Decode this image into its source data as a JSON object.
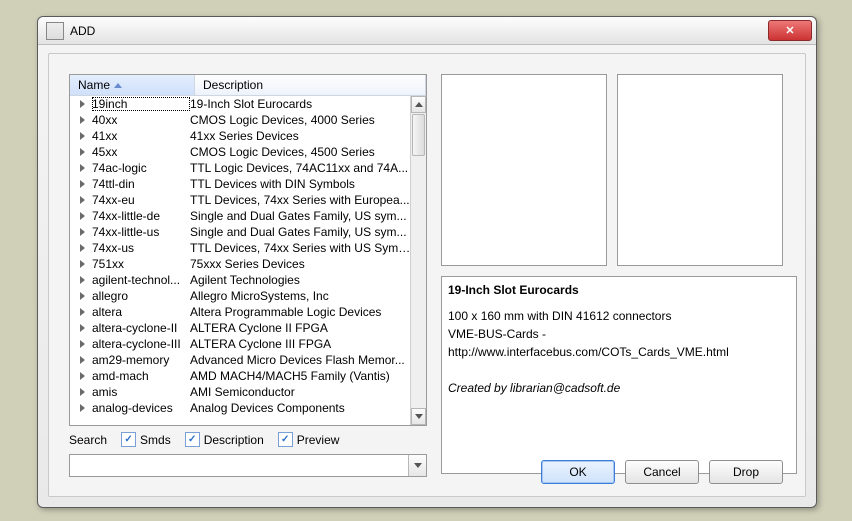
{
  "window": {
    "title": "ADD"
  },
  "columns": {
    "name": "Name",
    "description": "Description"
  },
  "rows": [
    {
      "name": "19inch",
      "desc": "19-Inch Slot Eurocards",
      "selected": true
    },
    {
      "name": "40xx",
      "desc": "CMOS Logic Devices, 4000 Series"
    },
    {
      "name": "41xx",
      "desc": "41xx Series Devices"
    },
    {
      "name": "45xx",
      "desc": "CMOS Logic Devices, 4500 Series"
    },
    {
      "name": "74ac-logic",
      "desc": "TTL Logic Devices, 74AC11xx and 74A..."
    },
    {
      "name": "74ttl-din",
      "desc": "TTL Devices with DIN Symbols"
    },
    {
      "name": "74xx-eu",
      "desc": "TTL Devices, 74xx Series with Europea..."
    },
    {
      "name": "74xx-little-de",
      "desc": "Single and Dual Gates Family, US sym..."
    },
    {
      "name": "74xx-little-us",
      "desc": "Single and Dual Gates Family, US sym..."
    },
    {
      "name": "74xx-us",
      "desc": "TTL Devices, 74xx Series with US Symb..."
    },
    {
      "name": "751xx",
      "desc": "75xxx Series Devices"
    },
    {
      "name": "agilent-technol...",
      "desc": "Agilent Technologies"
    },
    {
      "name": "allegro",
      "desc": "Allegro MicroSystems, Inc"
    },
    {
      "name": "altera",
      "desc": "Altera Programmable Logic Devices"
    },
    {
      "name": "altera-cyclone-II",
      "desc": "ALTERA Cyclone II FPGA"
    },
    {
      "name": "altera-cyclone-III",
      "desc": "ALTERA Cyclone III FPGA"
    },
    {
      "name": "am29-memory",
      "desc": "Advanced Micro Devices Flash Memor..."
    },
    {
      "name": "amd-mach",
      "desc": "AMD MACH4/MACH5 Family (Vantis)"
    },
    {
      "name": "amis",
      "desc": "AMI Semiconductor"
    },
    {
      "name": "analog-devices",
      "desc": "Analog Devices Components"
    }
  ],
  "detail": {
    "heading": "19-Inch Slot Eurocards",
    "line1": "100 x 160 mm with DIN 41612 connectors",
    "line2": "VME-BUS-Cards - http://www.interfacebus.com/COTs_Cards_VME.html",
    "credit": "Created by librarian@cadsoft.de"
  },
  "search": {
    "label": "Search",
    "smds": "Smds",
    "description": "Description",
    "preview": "Preview",
    "value": ""
  },
  "buttons": {
    "ok": "OK",
    "cancel": "Cancel",
    "drop": "Drop"
  }
}
